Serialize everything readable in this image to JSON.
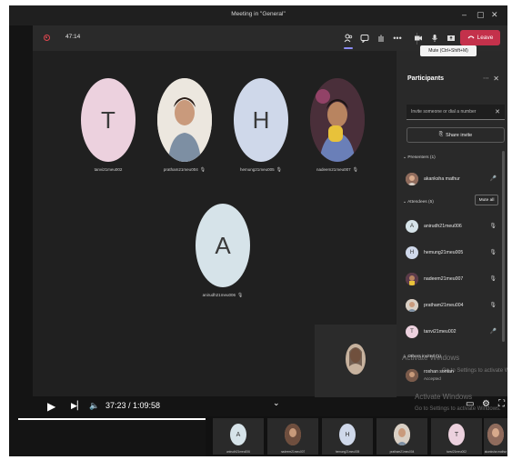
{
  "window": {
    "title": "Meeting in \"General\"",
    "minimize": "–",
    "maximize": "▢",
    "close": "✕"
  },
  "toolbar": {
    "timer": "47:14",
    "leave_label": "Leave",
    "tooltip": "Mute (Ctrl+Shift+M)",
    "icons": [
      "participants-icon",
      "chat-icon",
      "raise-hand-icon",
      "more-icon",
      "camera-icon",
      "mic-icon",
      "share-icon",
      "phone-icon"
    ]
  },
  "stage": {
    "tiles": [
      {
        "name": "tanvi21meu002",
        "initial": "T",
        "color": "#ecd1de",
        "muted": false,
        "photo": false
      },
      {
        "name": "pratham21meu004",
        "initial": "",
        "color": "#d9cfc4",
        "muted": true,
        "photo": true
      },
      {
        "name": "hemung21meu005",
        "initial": "H",
        "color": "#cfd8ea",
        "muted": true,
        "photo": false
      },
      {
        "name": "nadeem21meu007",
        "initial": "",
        "color": "#3d2b2b",
        "muted": true,
        "photo": true
      },
      {
        "name": "anirudh21meu006",
        "initial": "A",
        "color": "#d6e3e9",
        "muted": true,
        "photo": false
      }
    ]
  },
  "panel": {
    "title": "Participants",
    "invite_placeholder": "Invite someone or dial a number",
    "share_invite": "Share invite",
    "presenters_header": "Presenters (1)",
    "attendees_header": "Attendees (5)",
    "mute_all": "Mute all",
    "others_header": "Others invited (1)",
    "presenters": [
      {
        "name": "akanksha mathur",
        "initial": "",
        "color": "#b08a7a"
      }
    ],
    "attendees": [
      {
        "name": "anirudh21meu006",
        "initial": "A",
        "color": "#d6e3e9"
      },
      {
        "name": "hemung21meu005",
        "initial": "H",
        "color": "#cfd8ea"
      },
      {
        "name": "nadeem21meu007",
        "initial": "",
        "color": "#8a6a3a"
      },
      {
        "name": "pratham21meu004",
        "initial": "",
        "color": "#b89a86"
      },
      {
        "name": "tanvi21meu002",
        "initial": "T",
        "color": "#ecd1de"
      }
    ],
    "others": [
      {
        "name": "roshan sontan",
        "status": "Accepted",
        "initial": "",
        "color": "#9a7a6a"
      }
    ]
  },
  "watermark": {
    "line1": "Activate Windows",
    "line2": "Go to Settings to activate Windows."
  },
  "player": {
    "time": "37:23 / 1:09:58",
    "progress": 0.534
  },
  "strip": [
    {
      "name": "anirudh21meu006",
      "initial": "A",
      "color": "#d6e3e9"
    },
    {
      "name": "nadeem21meu007",
      "initial": "",
      "color": "#a17a5c"
    },
    {
      "name": "hemung21meu005",
      "initial": "H",
      "color": "#cfd8ea"
    },
    {
      "name": "pratham21meu004",
      "initial": "",
      "color": "#c9b2a0"
    },
    {
      "name": "tanvi21meu002",
      "initial": "T",
      "color": "#ecd1de"
    },
    {
      "name": "akanksha mathur",
      "initial": "",
      "color": "#b08a7a"
    }
  ]
}
